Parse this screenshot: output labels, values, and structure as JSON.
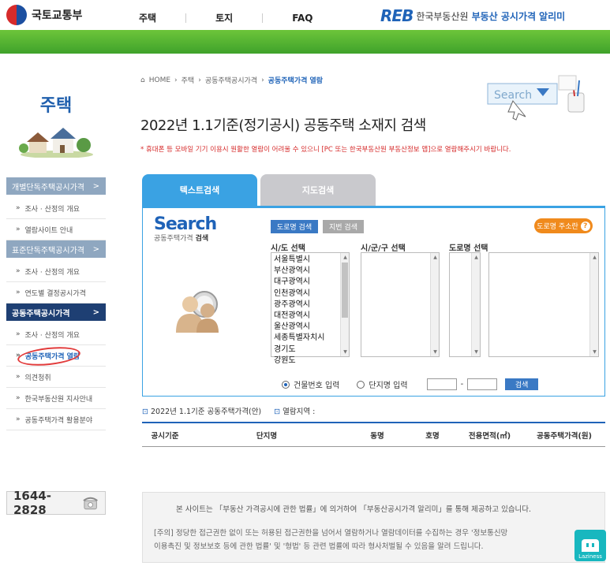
{
  "header": {
    "molit_name": "국토교통부",
    "nav": [
      "주택",
      "토지",
      "FAQ"
    ],
    "reb_mark": "REB",
    "reb_name": "한국부동산원",
    "reb_service": "부동산 공시가격",
    "reb_service2": "알리미"
  },
  "sidebar": {
    "title": "주택",
    "menu": [
      {
        "type": "header",
        "label": "개별단독주택공시가격",
        "arrow": ">"
      },
      {
        "type": "item",
        "label": "조사 · 산정의 개요"
      },
      {
        "type": "item",
        "label": "열람사이트 안내"
      },
      {
        "type": "header",
        "label": "표준단독주택공시가격",
        "arrow": ">"
      },
      {
        "type": "item",
        "label": "조사 · 산정의 개요"
      },
      {
        "type": "item",
        "label": "연도별 결정공시가격"
      },
      {
        "type": "header_active",
        "label": "공동주택공시가격",
        "arrow": ">"
      },
      {
        "type": "item",
        "label": "조사 · 산정의 개요"
      },
      {
        "type": "item_active",
        "label": "공동주택가격 열람"
      },
      {
        "type": "item",
        "label": "의견청취"
      },
      {
        "type": "item",
        "label": "한국부동산원 지사안내"
      },
      {
        "type": "item",
        "label": "공동주택가격 활용분야"
      }
    ],
    "phone": "1644-2828"
  },
  "breadcrumb": {
    "home": "HOME",
    "items": [
      "주택",
      "공동주택공시가격"
    ],
    "current": "공동주택가격 열람"
  },
  "page_title": "2022년 1.1기준(정기공시) 공동주택 소재지 검색",
  "notice": "* 휴대폰 등 모바일 기기 이용시 원활한 열람이 어려울 수 있으니 [PC 또는 한국부동산원 부동산정보 앱]으로 열람해주시기 바랍니다.",
  "illustration": {
    "search_label": "Search"
  },
  "tabs": {
    "text": "텍스트검색",
    "map": "지도검색"
  },
  "search": {
    "title": "Search",
    "subtitle_a": "공동주택가격",
    "subtitle_b": "검색",
    "btn_road": "도로명 검색",
    "btn_lot": "지번 검색",
    "btn_road_addr": "도로명 주소란",
    "labels": {
      "sido": "시/도 선택",
      "sgg": "시/군/구 선택",
      "road": "도로명 선택"
    },
    "sido_list": [
      "서울특별시",
      "부산광역시",
      "대구광역시",
      "인천광역시",
      "광주광역시",
      "대전광역시",
      "울산광역시",
      "세종특별자치시",
      "경기도",
      "강원도"
    ],
    "radio_building": "건물번호 입력",
    "radio_complex": "단지명 입력",
    "dash": "-",
    "btn_search": "검색"
  },
  "result": {
    "info_year": "2022년 1.1기준 공동주택가격(안)",
    "info_area": "열람지역 :",
    "columns": [
      "공시기준",
      "단지명",
      "동명",
      "호명",
      "전용면적(㎡)",
      "공동주택가격(원)"
    ]
  },
  "footer": {
    "line1": "본 사이트는 「부동산 가격공시에 관한 법률」에 의거하여 「부동산공시가격 알리미」를 통해 제공하고 있습니다.",
    "line2": "[주의] 정당한 접근권한 없이 또는 허용된 접근권한을 넘어서 열람하거나 열람데이터를 수집하는 경우 '정보통신망",
    "line3": "이용촉진 및 정보보호 등에 관한 법률' 및 '형법' 등 관련 법률에 따라 형사처벌될 수 있음을 알려 드립니다."
  },
  "badge": {
    "label": "Laziness"
  },
  "colors": {
    "accent_blue": "#1f63b8",
    "tab_blue": "#3aa2e3",
    "green_bar": "#4fb12f",
    "notice_red": "#d62b2b",
    "orange": "#f08a1c"
  }
}
